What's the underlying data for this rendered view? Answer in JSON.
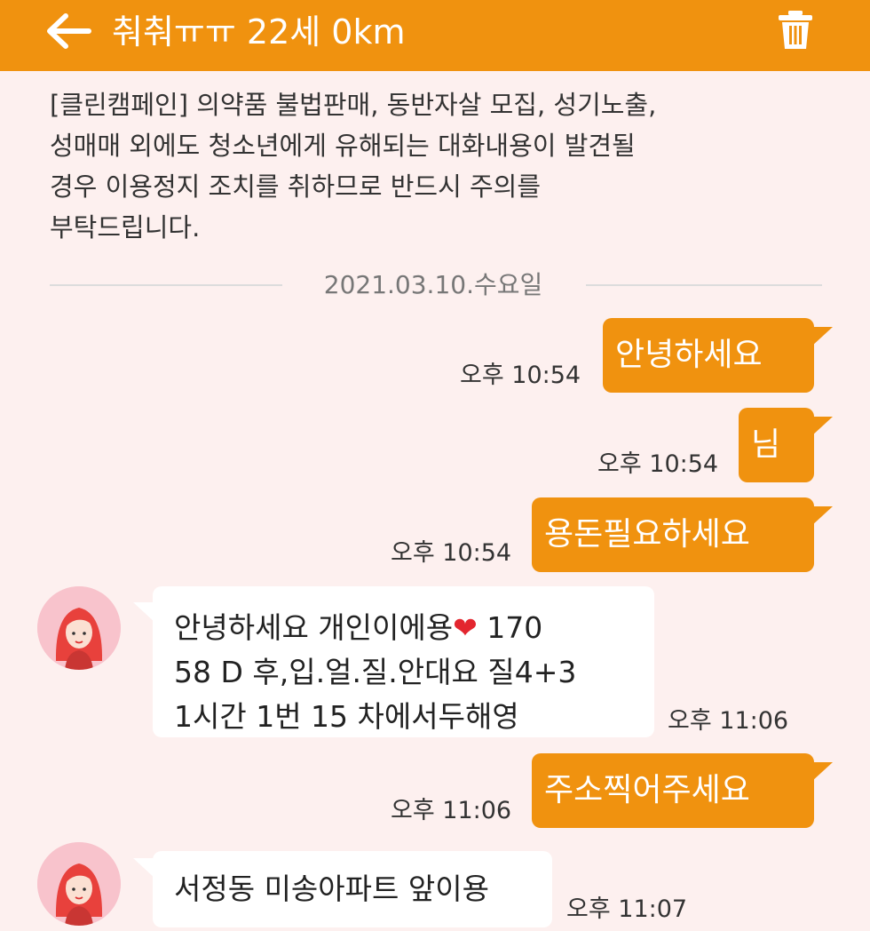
{
  "header": {
    "title": "춰춰ㅠㅠ 22세 0km",
    "back_icon": "arrow-left-icon",
    "trash_icon": "trash-icon",
    "background": "#f0920f"
  },
  "notice": "[클린캠페인] 의약품 불법판매, 동반자살 모집, 성기노출,\n성매매 외에도 청소년에게 유해되는 대화내용이 발견될\n경우 이용정지 조치를 취하므로 반드시 주의를\n부탁드립니다.",
  "date_separator": "2021.03.10.수요일",
  "messages": [
    {
      "direction": "out",
      "text": "안녕하세요",
      "time": "오후 10:54"
    },
    {
      "direction": "out",
      "text": "님",
      "time": "오후 10:54"
    },
    {
      "direction": "out",
      "text": "용돈필요하세요",
      "time": "오후 10:54"
    },
    {
      "direction": "in",
      "text_before_heart": "안녕하세요  개인이에용",
      "heart": "❤",
      "text_after_heart": "  170\n58 D 후,입.얼.질.안대요 질4+3\n1시간 1번 15 차에서두해영",
      "time": "오후 11:06"
    },
    {
      "direction": "out",
      "text": "주소찍어주세요",
      "time": "오후 11:06"
    },
    {
      "direction": "in",
      "text": "서정동 미송아파트 앞이용",
      "time": "오후 11:07"
    }
  ],
  "colors": {
    "accent": "#f0920f",
    "background": "#fdf0ef",
    "incoming_bubble": "#ffffff"
  }
}
